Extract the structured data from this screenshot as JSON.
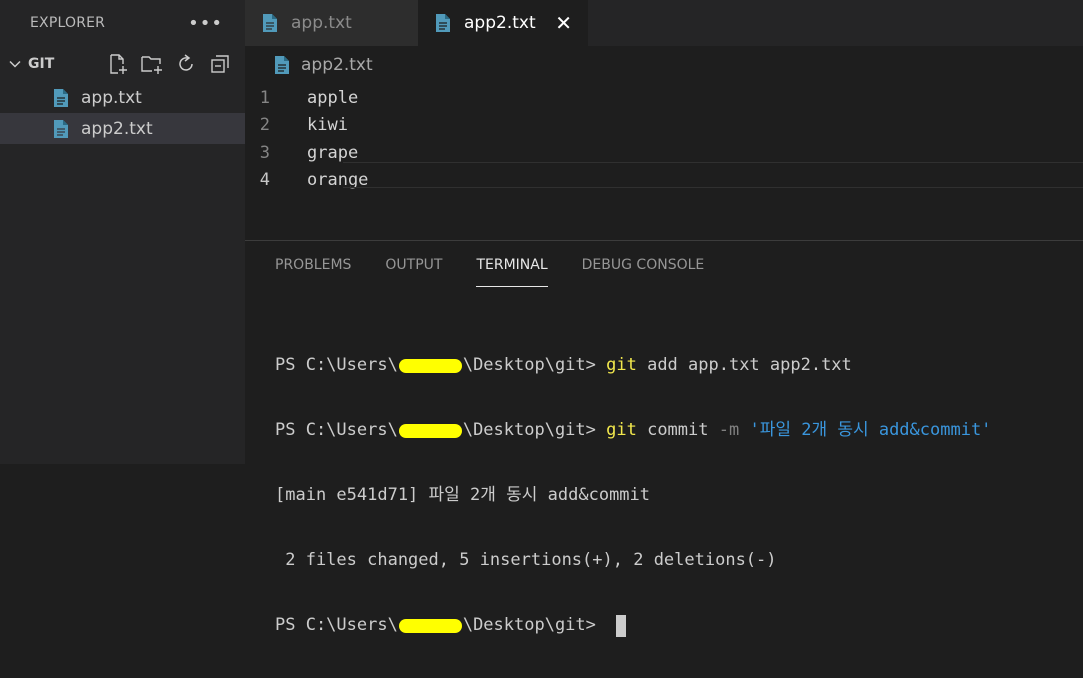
{
  "sidebar": {
    "title": "EXPLORER",
    "more_icon": "more-icon",
    "section_title": "GIT",
    "actions": [
      "new-file-icon",
      "new-folder-icon",
      "refresh-icon",
      "collapse-all-icon"
    ],
    "files": [
      {
        "name": "app.txt",
        "selected": false
      },
      {
        "name": "app2.txt",
        "selected": true
      }
    ]
  },
  "tabs": [
    {
      "label": "app.txt",
      "active": false
    },
    {
      "label": "app2.txt",
      "active": true
    }
  ],
  "breadcrumb": "app2.txt",
  "editor": {
    "lines": [
      {
        "num": "1",
        "text": "apple"
      },
      {
        "num": "2",
        "text": "kiwi"
      },
      {
        "num": "3",
        "text": "grape"
      },
      {
        "num": "4",
        "text": "orange"
      }
    ]
  },
  "panel": {
    "tabs": [
      "PROBLEMS",
      "OUTPUT",
      "TERMINAL",
      "DEBUG CONSOLE"
    ],
    "active_tab": "TERMINAL"
  },
  "terminal": {
    "prompt_prefix": "PS C:\\Users\\",
    "prompt_suffix": "\\Desktop\\git> ",
    "line1_cmd": "git",
    "line1_args": " add app.txt app2.txt",
    "line2_cmd": "git",
    "line2_args": " commit ",
    "line2_flag": "-m",
    "line2_str": " '파일 2개 동시 add&commit'",
    "out1": "[main e541d71] 파일 2개 동시 add&commit",
    "out2": " 2 files changed, 5 insertions(+), 2 deletions(-)"
  },
  "colors": {
    "file_icon": "#519aba",
    "redaction": "#ffff00"
  }
}
